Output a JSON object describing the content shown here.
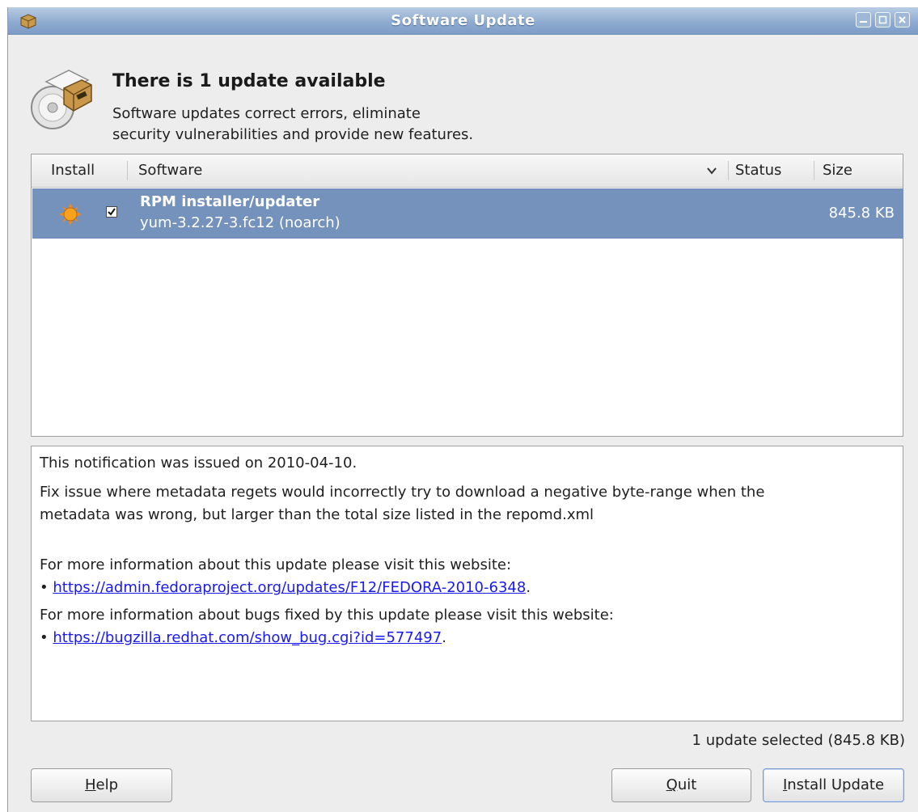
{
  "window": {
    "title": "Software Update"
  },
  "header": {
    "heading": "There is 1 update available",
    "subtext_line1": "Software updates correct errors, eliminate",
    "subtext_line2": "security vulnerabilities and provide new features."
  },
  "list": {
    "columns": {
      "install": "Install",
      "software": "Software",
      "status": "Status",
      "size": "Size"
    },
    "rows": [
      {
        "name": "RPM installer/updater",
        "version": "yum-3.2.27-3.fc12 (noarch)",
        "status": "",
        "size": "845.8 KB",
        "checked": true,
        "selected": true,
        "severity_icon": "bugfix-sun-icon"
      }
    ]
  },
  "details": {
    "issued": "This notification was issued on 2010-04-10.",
    "desc_line1": "Fix issue where metadata regets would incorrectly try to download a negative byte-range when the",
    "desc_line2": "metadata was wrong, but larger than the total size listed in the repomd.xml",
    "website_intro": "For more information about this update please visit this website:",
    "website_bullet": "•",
    "website_link": "https://admin.fedoraproject.org/updates/F12/FEDORA-2010-6348",
    "website_punct": ".",
    "bugs_intro": "For more information about bugs fixed by this update please visit this website:",
    "bugs_bullet": "•",
    "bugs_link": "https://bugzilla.redhat.com/show_bug.cgi?id=577497",
    "bugs_punct": "."
  },
  "summary": "1 update selected (845.8 KB)",
  "buttons": {
    "help_mnemonic": "H",
    "help_rest": "elp",
    "quit_mnemonic": "Q",
    "quit_rest": "uit",
    "install_mnemonic": "I",
    "install_rest": "nstall Update"
  },
  "colors": {
    "titlebar": "#8fabd0",
    "selection": "#7592bd",
    "link": "#1a1aee"
  }
}
